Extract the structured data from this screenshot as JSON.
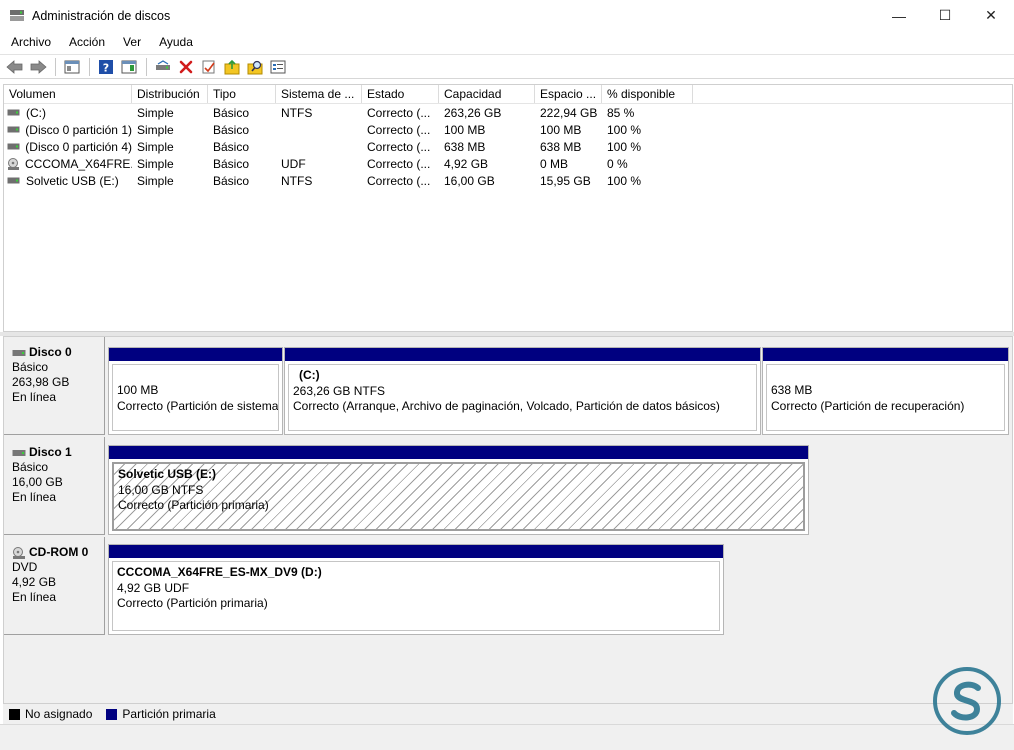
{
  "window": {
    "title": "Administración de discos",
    "controls": {
      "minimize": "—",
      "maximize": "☐",
      "close": "✕"
    }
  },
  "menu": [
    "Archivo",
    "Acción",
    "Ver",
    "Ayuda"
  ],
  "toolbar": {
    "icons": [
      "back-icon",
      "forward-icon",
      "show-hide-console-tree-icon",
      "help-icon",
      "action-pane-icon",
      "connect-drive-icon",
      "delete-icon",
      "properties-icon",
      "open-folder-icon",
      "explore-icon",
      "settings-icon"
    ]
  },
  "table": {
    "columns": [
      "Volumen",
      "Distribución",
      "Tipo",
      "Sistema de ...",
      "Estado",
      "Capacidad",
      "Espacio ...",
      "% disponible"
    ],
    "rows": [
      {
        "icon": "drive-icon",
        "cells": [
          "(C:)",
          "Simple",
          "Básico",
          "NTFS",
          "Correcto (...",
          "263,26 GB",
          "222,94 GB",
          "85 %"
        ]
      },
      {
        "icon": "drive-icon",
        "cells": [
          "(Disco 0 partición 1)",
          "Simple",
          "Básico",
          "",
          "Correcto (...",
          "100 MB",
          "100 MB",
          "100 %"
        ]
      },
      {
        "icon": "drive-icon",
        "cells": [
          "(Disco 0 partición 4)",
          "Simple",
          "Básico",
          "",
          "Correcto (...",
          "638 MB",
          "638 MB",
          "100 %"
        ]
      },
      {
        "icon": "cd-drive-icon",
        "cells": [
          "CCCOMA_X64FRE...",
          "Simple",
          "Básico",
          "UDF",
          "Correcto (...",
          "4,92 GB",
          "0 MB",
          "0 %"
        ]
      },
      {
        "icon": "drive-icon",
        "cells": [
          "Solvetic USB (E:)",
          "Simple",
          "Básico",
          "NTFS",
          "Correcto (...",
          "16,00 GB",
          "15,95 GB",
          "100 %"
        ]
      }
    ]
  },
  "disks": [
    {
      "name": "Disco 0",
      "type": "Básico",
      "size": "263,98 GB",
      "status": "En línea",
      "partitions": [
        {
          "title": "",
          "size": "100 MB",
          "status": "Correcto (Partición de sistema"
        },
        {
          "title": "(C:)",
          "size": "263,26 GB NTFS",
          "status": "Correcto (Arranque, Archivo de paginación, Volcado, Partición de datos básicos)"
        },
        {
          "title": "",
          "size": "638 MB",
          "status": "Correcto (Partición de recuperación)"
        }
      ]
    },
    {
      "name": "Disco 1",
      "type": "Básico",
      "size": "16,00 GB",
      "status": "En línea",
      "partitions": [
        {
          "title": "Solvetic USB  (E:)",
          "size": "16,00 GB NTFS",
          "status": "Correcto (Partición primaria)"
        }
      ]
    },
    {
      "name": "CD-ROM 0",
      "type": "DVD",
      "size": "4,92 GB",
      "status": "En línea",
      "partitions": [
        {
          "title": "CCCOMA_X64FRE_ES-MX_DV9  (D:)",
          "size": "4,92 GB UDF",
          "status": "Correcto (Partición primaria)"
        }
      ]
    }
  ],
  "legend": {
    "items": [
      {
        "label": "No asignado",
        "color": "#000000"
      },
      {
        "label": "Partición primaria",
        "color": "#000080"
      }
    ]
  },
  "colors": {
    "partition_bar": "#000080",
    "logo": "#1f6f8b"
  }
}
